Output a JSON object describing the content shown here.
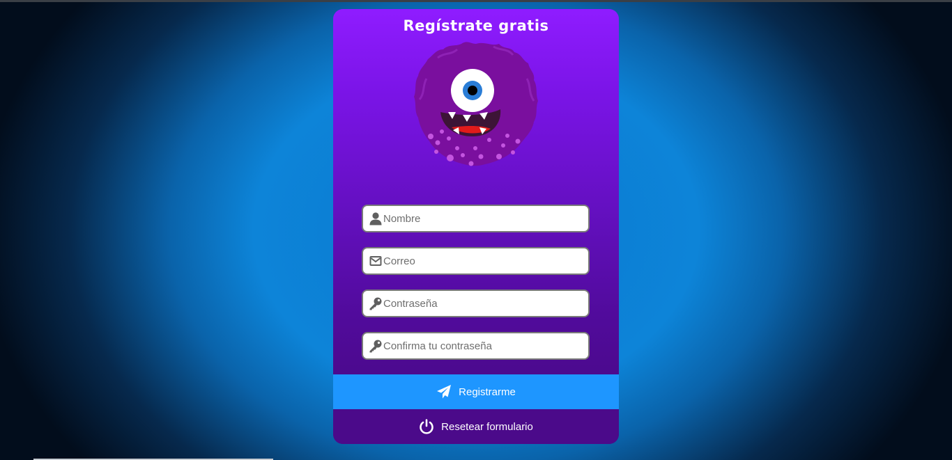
{
  "form": {
    "title": "Regístrate gratis",
    "fields": [
      {
        "placeholder": "Nombre",
        "value": "",
        "icon": "user-icon"
      },
      {
        "placeholder": "Correo",
        "value": "",
        "icon": "envelope-icon"
      },
      {
        "placeholder": "Contraseña",
        "value": "",
        "icon": "key-icon"
      },
      {
        "placeholder": "Confirma tu contraseña",
        "value": "",
        "icon": "key-icon"
      }
    ],
    "register_label": "Registrarme",
    "register_icon": "paper-plane-icon",
    "reset_label": "Resetear formulario",
    "reset_icon": "power-icon"
  },
  "colors": {
    "card_top": "#8f1cff",
    "card_bottom": "#46097f",
    "register_button": "#1e96ff",
    "reset_button": "#4b0a8a",
    "monster_body": "#7a0f9e"
  }
}
